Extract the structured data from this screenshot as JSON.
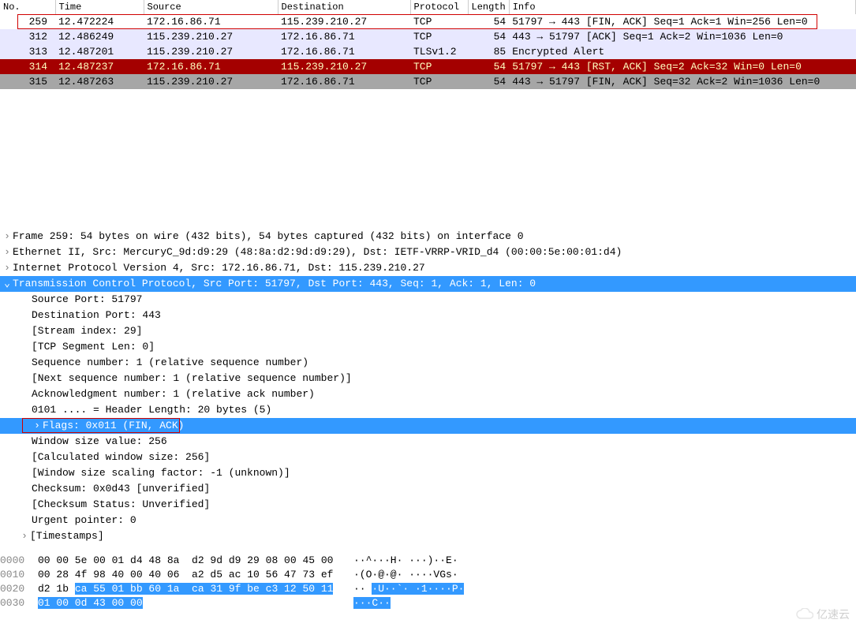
{
  "columns": {
    "no": "No.",
    "time": "Time",
    "source": "Source",
    "destination": "Destination",
    "protocol": "Protocol",
    "length": "Length",
    "info": "Info"
  },
  "packets": [
    {
      "no": "259",
      "time": "12.472224",
      "src": "172.16.86.71",
      "dst": "115.239.210.27",
      "proto": "TCP",
      "len": "54",
      "info": "51797 → 443 [FIN, ACK] Seq=1 Ack=1 Win=256 Len=0",
      "cls": "row-white"
    },
    {
      "no": "312",
      "time": "12.486249",
      "src": "115.239.210.27",
      "dst": "172.16.86.71",
      "proto": "TCP",
      "len": "54",
      "info": "443 → 51797 [ACK] Seq=1 Ack=2 Win=1036 Len=0",
      "cls": "row-light"
    },
    {
      "no": "313",
      "time": "12.487201",
      "src": "115.239.210.27",
      "dst": "172.16.86.71",
      "proto": "TLSv1.2",
      "len": "85",
      "info": "Encrypted Alert",
      "cls": "row-light"
    },
    {
      "no": "314",
      "time": "12.487237",
      "src": "172.16.86.71",
      "dst": "115.239.210.27",
      "proto": "TCP",
      "len": "54",
      "info": "51797 → 443 [RST, ACK] Seq=2 Ack=32 Win=0 Len=0",
      "cls": "row-red"
    },
    {
      "no": "315",
      "time": "12.487263",
      "src": "115.239.210.27",
      "dst": "172.16.86.71",
      "proto": "TCP",
      "len": "54",
      "info": "443 → 51797 [FIN, ACK] Seq=32 Ack=2 Win=1036 Len=0",
      "cls": "row-gray"
    }
  ],
  "details": {
    "frame": "Frame 259: 54 bytes on wire (432 bits), 54 bytes captured (432 bits) on interface 0",
    "eth": "Ethernet II, Src: MercuryC_9d:d9:29 (48:8a:d2:9d:d9:29), Dst: IETF-VRRP-VRID_d4 (00:00:5e:00:01:d4)",
    "ip": "Internet Protocol Version 4, Src: 172.16.86.71, Dst: 115.239.210.27",
    "tcp": "Transmission Control Protocol, Src Port: 51797, Dst Port: 443, Seq: 1, Ack: 1, Len: 0",
    "src_port": "Source Port: 51797",
    "dst_port": "Destination Port: 443",
    "stream": "[Stream index: 29]",
    "seglen": "[TCP Segment Len: 0]",
    "seq": "Sequence number: 1    (relative sequence number)",
    "nextseq": "[Next sequence number: 1    (relative sequence number)]",
    "ack": "Acknowledgment number: 1    (relative ack number)",
    "hdrlen": "0101 .... = Header Length: 20 bytes (5)",
    "flags": "Flags: 0x011 (FIN, ACK)",
    "winsize": "Window size value: 256",
    "calcwin": "[Calculated window size: 256]",
    "winscale": "[Window size scaling factor: -1 (unknown)]",
    "checksum": "Checksum: 0x0d43 [unverified]",
    "chkstatus": "[Checksum Status: Unverified]",
    "urgent": "Urgent pointer: 0",
    "timestamps": "[Timestamps]"
  },
  "bytes": {
    "r0": {
      "off": "0000",
      "hex": "00 00 5e 00 01 d4 48 8a  d2 9d d9 29 08 00 45 00",
      "ascii": "··^···H· ···)··E·"
    },
    "r1": {
      "off": "0010",
      "hex": "00 28 4f 98 40 00 40 06  a2 d5 ac 10 56 47 73 ef",
      "ascii": "·(O·@·@· ····VGs·"
    },
    "r2": {
      "off": "0020",
      "hex_pre": "d2 1b ",
      "hex_hl": "ca 55 01 bb 60 1a  ca 31 9f be c3 12 50 11",
      "ascii_pre": "·· ",
      "ascii_hl": "·U··`· ·1····P·"
    },
    "r3": {
      "off": "0030",
      "hex_hl": "01 00 0d 43 00 00",
      "ascii_hl": "···C··"
    }
  },
  "watermark": "亿速云"
}
